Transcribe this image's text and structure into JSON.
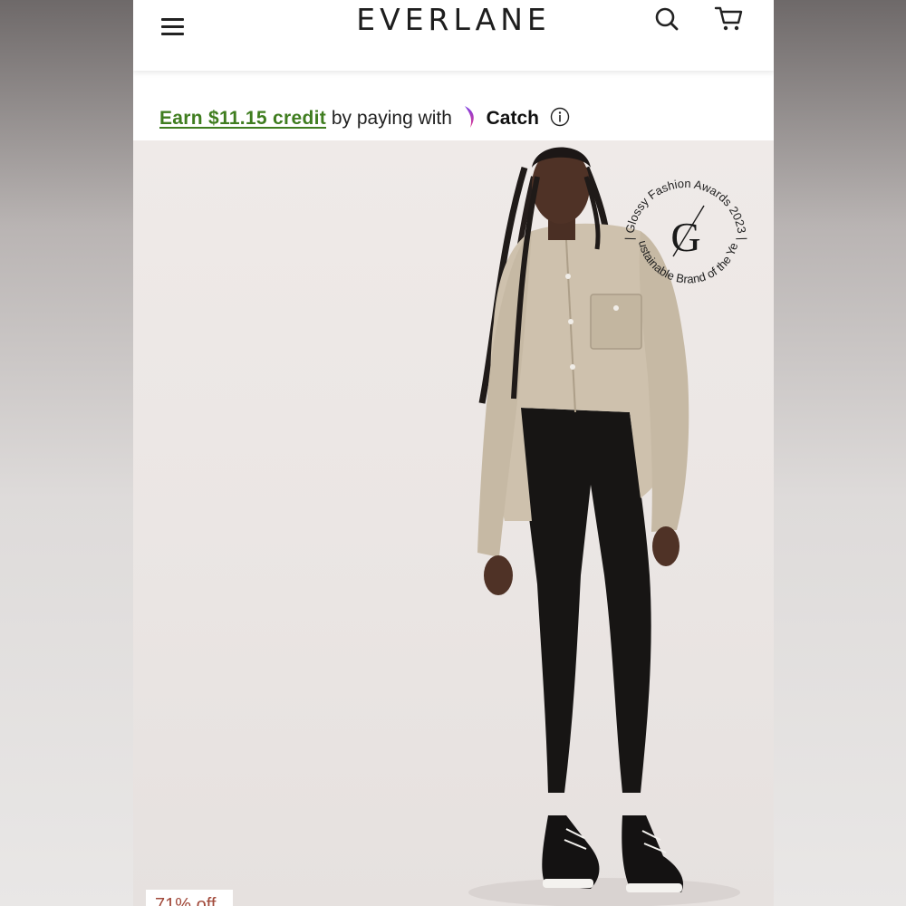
{
  "header": {
    "brand": "EVERLANE"
  },
  "promo": {
    "earn_text": "Earn $11.15 credit",
    "middle_text": "by paying with",
    "provider": "Catch",
    "info_symbol": "ⓘ"
  },
  "badge": {
    "arc_top": "| Glossy Fashion Awards 2023 |",
    "arc_bottom": "Sustainable Brand of the Year",
    "monogram": "G"
  },
  "product": {
    "discount_label": "71% off"
  },
  "colors": {
    "promo_link": "#3f7d1f",
    "catch_gradient_start": "#7b3fe4",
    "catch_gradient_end": "#e23d8f",
    "discount": "#a1493a"
  }
}
